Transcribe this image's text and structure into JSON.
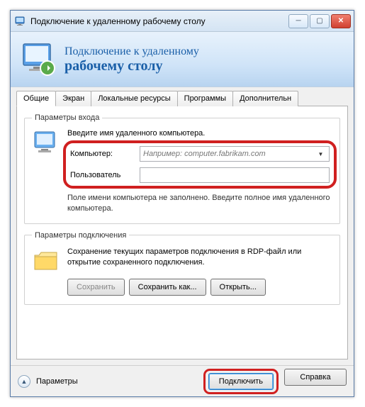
{
  "titlebar": {
    "title": "Подключение к удаленному рабочему столу"
  },
  "banner": {
    "line1": "Подключение к удаленному",
    "line2": "рабочему столу"
  },
  "tabs": {
    "items": [
      {
        "label": "Общие"
      },
      {
        "label": "Экран"
      },
      {
        "label": "Локальные ресурсы"
      },
      {
        "label": "Программы"
      },
      {
        "label": "Дополнительн"
      }
    ]
  },
  "login": {
    "legend": "Параметры входа",
    "intro": "Введите имя удаленного компьютера.",
    "computer_label": "Компьютер:",
    "computer_placeholder": "Например: computer.fabrikam.com",
    "user_label": "Пользователь",
    "hint": "Поле имени компьютера не заполнено. Введите полное имя удаленного компьютера."
  },
  "connection": {
    "legend": "Параметры подключения",
    "desc": "Сохранение текущих параметров подключения в RDP-файл или открытие сохраненного подключения.",
    "save": "Сохранить",
    "save_as": "Сохранить как...",
    "open": "Открыть..."
  },
  "footer": {
    "options": "Параметры",
    "connect": "Подключить",
    "help": "Справка"
  }
}
